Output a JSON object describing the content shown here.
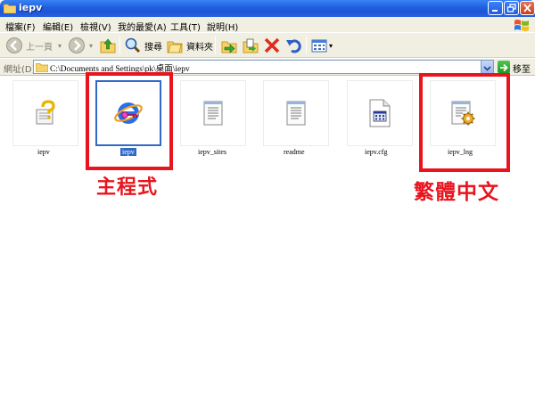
{
  "window": {
    "title": "iepv"
  },
  "menu": [
    {
      "label": "檔案(F)"
    },
    {
      "label": "編輯(E)"
    },
    {
      "label": "檢視(V)"
    },
    {
      "label": "我的最愛(A)"
    },
    {
      "label": "工具(T)"
    },
    {
      "label": "說明(H)"
    }
  ],
  "toolbar": {
    "back_label": "上一頁",
    "search_label": "搜尋",
    "folders_label": "資料夾"
  },
  "address": {
    "label": "網址(D)",
    "path": "C:\\Documents and Settings\\pk\\桌面\\iepv",
    "go_label": "移至"
  },
  "files": [
    {
      "name": "iepv",
      "icon": "help-file-icon"
    },
    {
      "name": "iepv",
      "icon": "ie-program-icon",
      "selected": true
    },
    {
      "name": "iepv_sites",
      "icon": "text-document-icon"
    },
    {
      "name": "readme",
      "icon": "text-document-icon"
    },
    {
      "name": "iepv.cfg",
      "icon": "config-file-icon"
    },
    {
      "name": "iepv_lng",
      "icon": "ini-settings-icon"
    }
  ],
  "annotations": {
    "main_program": "主程式",
    "traditional_chinese": "繁體中文"
  },
  "colors": {
    "titlebar": "#1f5fe0",
    "selection": "#316ac5",
    "annotation_red": "#e8141e",
    "chrome": "#f1efe2"
  }
}
